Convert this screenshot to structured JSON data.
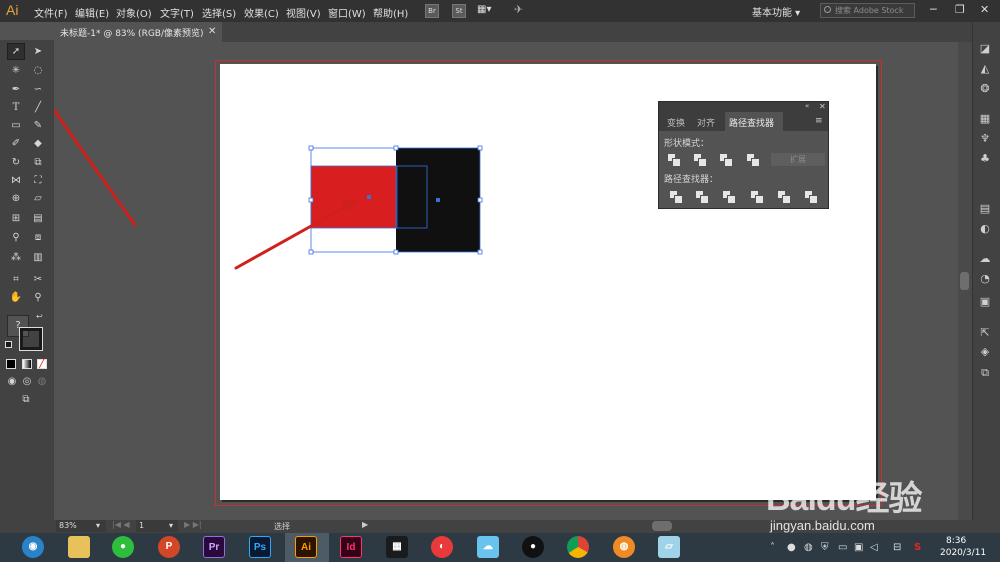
{
  "app": {
    "logo": "Ai",
    "menu": [
      "文件(F)",
      "编辑(E)",
      "对象(O)",
      "文字(T)",
      "选择(S)",
      "效果(C)",
      "视图(V)",
      "窗口(W)",
      "帮助(H)"
    ],
    "bridge_buttons": [
      "Br",
      "St"
    ],
    "workspace": "基本功能",
    "search_placeholder": "搜索 Adobe Stock"
  },
  "document": {
    "tab_title": "未标题-1* @ 83% (RGB/像素预览)"
  },
  "pathfinder_panel": {
    "tabs": [
      "变换",
      "对齐",
      "路径查找器"
    ],
    "active_tab": "路径查找器",
    "shape_modes_label": "形状模式：",
    "pathfinders_label": "路径查找器：",
    "expand_button": "扩展"
  },
  "artwork": {
    "red_fill": "#d81e1e",
    "black_fill": "#111010",
    "selection_color": "#3a6fd8",
    "arrow_color": "#d0201c"
  },
  "status_bar": {
    "zoom": "83%",
    "page": "1",
    "tool": "选择"
  },
  "taskbar": {
    "apps": [
      "Pr",
      "Ps",
      "Ai",
      "Id"
    ],
    "time": "8:36",
    "date": "2020/3/11"
  },
  "watermark": {
    "title": "Baidu经验",
    "site": "jingyan.baidu.com"
  }
}
